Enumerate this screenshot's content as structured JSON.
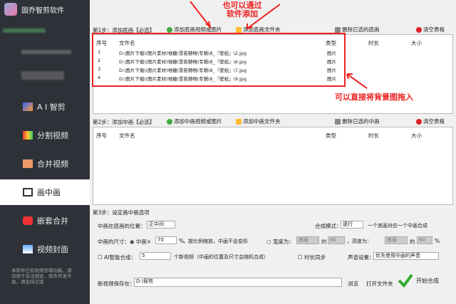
{
  "app": {
    "title": "固乔智剪软件"
  },
  "sidebar": {
    "items": [
      {
        "label": "A I 智剪",
        "icon": "ai-pen-icon"
      },
      {
        "label": "分割视频",
        "icon": "split-icon"
      },
      {
        "label": "合并视频",
        "icon": "merge-icon"
      },
      {
        "label": "画中画",
        "icon": "pip-icon",
        "active": true
      },
      {
        "label": "嵌套合并",
        "icon": "nest-icon"
      },
      {
        "label": "视频封面",
        "icon": "cover-icon"
      }
    ],
    "footer": "本软件已有视频剪辑功能，请勿用于非法用途，软件开发不易，请支持正版"
  },
  "step1": {
    "title": "第1步：添加底画【必选】",
    "add_media": "添加底画视频或图片",
    "add_folder": "添加底画文件夹",
    "delete": "删除已选的底画",
    "clear": "清空表格",
    "columns": [
      "序号",
      "文件名",
      "类型",
      "时长",
      "大小"
    ],
    "rows": [
      [
        "1",
        "D:\\图片下载\\(图片素材)堆糖\\雪若赫畅\\专辑\\8_『壁纸』\\2.jpg",
        "图片",
        "",
        ""
      ],
      [
        "2",
        "D:\\图片下载\\(图片素材)堆糖\\雪若赫畅\\专辑\\8_『壁纸』\\6.jpg",
        "图片",
        "",
        ""
      ],
      [
        "3",
        "D:\\图片下载\\(图片素材)堆糖\\雪若赫畅\\专辑\\8_『壁纸』\\7.jpg",
        "图片",
        "",
        ""
      ],
      [
        "4",
        "D:\\图片下载\\(图片素材)堆糖\\雪若赫畅\\专辑\\8_『壁纸』\\9.jpg",
        "图片",
        "",
        ""
      ]
    ]
  },
  "step2": {
    "title": "第2步：添加中画【必选】",
    "add_media": "添加中画视频或图片",
    "add_folder": "添加中画文件夹",
    "delete": "删除已选的中画",
    "clear": "清空表格",
    "columns": [
      "序号",
      "文件名",
      "类型",
      "时长",
      "大小"
    ]
  },
  "annotations": {
    "top": "也可以通过\n软件添加",
    "right": "可以直接将背景图拖入"
  },
  "step3": {
    "title": "第3步：设定画中画选项",
    "position_label": "中画在底画的位置：",
    "position_value": "正中间",
    "mode_label": "合成模式：",
    "mode_value": "逐行",
    "mode_desc": "一个底画对应一个中画合成",
    "size_label": "中画的尺寸：",
    "size_option": "中画×",
    "size_value": "70",
    "pct": "%",
    "size_desc": "，按比例缩放，中画不会变形",
    "width_option": "宽度为：",
    "width_value": "底画",
    "of": "的",
    "width_pct": "60",
    "height_label": "，高度为：",
    "height_value": "底画",
    "height_pct": "60",
    "ai_label": "AI智能合成：",
    "ai_value": "5",
    "ai_desc": "个新视频（中画的位置及尺寸会随机合成）",
    "sync_label": "时长同步",
    "sound_label": "声音设置：",
    "sound_value": "优先使用中画的声音"
  },
  "save": {
    "label": "新视频保存在：",
    "path": "D:\\智剪",
    "browse": "浏览",
    "open": "打开文件夹"
  },
  "start": {
    "label": "开始合成"
  }
}
